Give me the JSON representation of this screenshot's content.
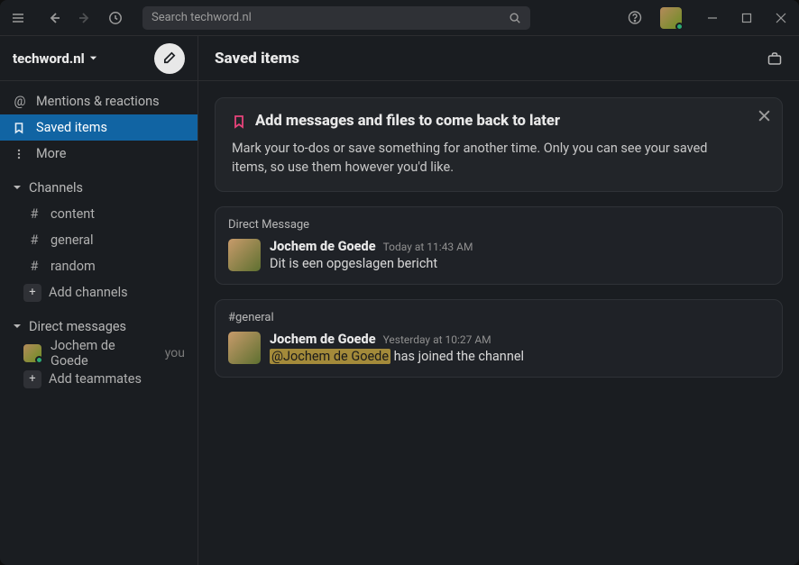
{
  "search": {
    "placeholder": "Search techword.nl"
  },
  "workspace": {
    "name": "techword.nl"
  },
  "sidebar": {
    "mentions": "Mentions & reactions",
    "saved": "Saved items",
    "more": "More",
    "channels_label": "Channels",
    "channels": [
      {
        "name": "content"
      },
      {
        "name": "general"
      },
      {
        "name": "random"
      }
    ],
    "add_channels": "Add channels",
    "dm_label": "Direct messages",
    "dms": [
      {
        "name": "Jochem de Goede",
        "suffix": "you"
      }
    ],
    "add_teammates": "Add teammates"
  },
  "main": {
    "title": "Saved items"
  },
  "banner": {
    "title": "Add messages and files to come back to later",
    "body": "Mark your to-dos or save something for another time. Only you can see your saved items, so use them however you'd like."
  },
  "messages": [
    {
      "source": "Direct Message",
      "author": "Jochem de Goede",
      "time": "Today at 11:43 AM",
      "text": "Dit is een opgeslagen bericht"
    },
    {
      "source": "#general",
      "author": "Jochem de Goede",
      "time": "Yesterday at 10:27 AM",
      "mention": "@Jochem de Goede",
      "text_after": " has joined the channel"
    }
  ]
}
